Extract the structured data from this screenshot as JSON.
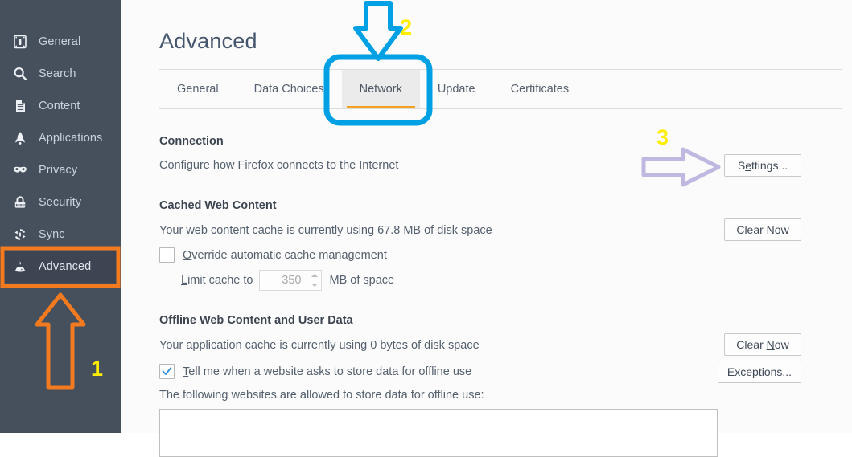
{
  "sidebar": {
    "items": [
      {
        "label": "General",
        "icon": "general-icon",
        "selected": false
      },
      {
        "label": "Search",
        "icon": "search-icon",
        "selected": false
      },
      {
        "label": "Content",
        "icon": "content-page-icon",
        "selected": false
      },
      {
        "label": "Applications",
        "icon": "rocket-icon",
        "selected": false
      },
      {
        "label": "Privacy",
        "icon": "mask-icon",
        "selected": false
      },
      {
        "label": "Security",
        "icon": "padlock-icon",
        "selected": false
      },
      {
        "label": "Sync",
        "icon": "sync-icon",
        "selected": false
      },
      {
        "label": "Advanced",
        "icon": "potion-icon",
        "selected": true
      }
    ]
  },
  "header": {
    "title": "Advanced"
  },
  "tabs": [
    {
      "label": "General",
      "active": false
    },
    {
      "label": "Data Choices",
      "active": false
    },
    {
      "label": "Network",
      "active": true
    },
    {
      "label": "Update",
      "active": false
    },
    {
      "label": "Certificates",
      "active": false
    }
  ],
  "connection": {
    "heading": "Connection",
    "description": "Configure how Firefox connects to the Internet",
    "settings_button": "Settings..."
  },
  "cached_web_content": {
    "heading": "Cached Web Content",
    "usage_text": "Your web content cache is currently using 67.8 MB of disk space",
    "clear_button": "Clear Now",
    "override_checkbox_label": "Override automatic cache management",
    "override_checked": false,
    "limit_label": "Limit cache to",
    "limit_value": "350",
    "limit_suffix": "MB of space"
  },
  "offline_content": {
    "heading": "Offline Web Content and User Data",
    "usage_text": "Your application cache is currently using 0 bytes of disk space",
    "clear_button": "Clear Now",
    "notify_checkbox_label": "Tell me when a website asks to store data for offline use",
    "notify_checked": true,
    "exceptions_button": "Exceptions...",
    "allowed_list_label": "The following websites are allowed to store data for offline use:",
    "allowed_sites": []
  },
  "annotations": [
    {
      "number": "1",
      "target": "sidebar-item-advanced",
      "shape": "up-arrow",
      "color": "#f47a20"
    },
    {
      "number": "2",
      "target": "tab-network",
      "shape": "down-arrow",
      "color": "#00a0e4"
    },
    {
      "number": "3",
      "target": "settings-button",
      "shape": "right-arrow",
      "color": "#c0b8e0"
    }
  ],
  "colors": {
    "sidebar_bg": "#46505c",
    "sidebar_selected_bg": "#3c4551",
    "accent_orange": "#f5a01e",
    "annotation_orange": "#f47a20",
    "annotation_blue": "#00a0e4",
    "annotation_purple": "#c0b8e0",
    "annotation_number": "#ffee00",
    "checkbox_check": "#3a8fd8",
    "heading_text": "#46566e"
  }
}
